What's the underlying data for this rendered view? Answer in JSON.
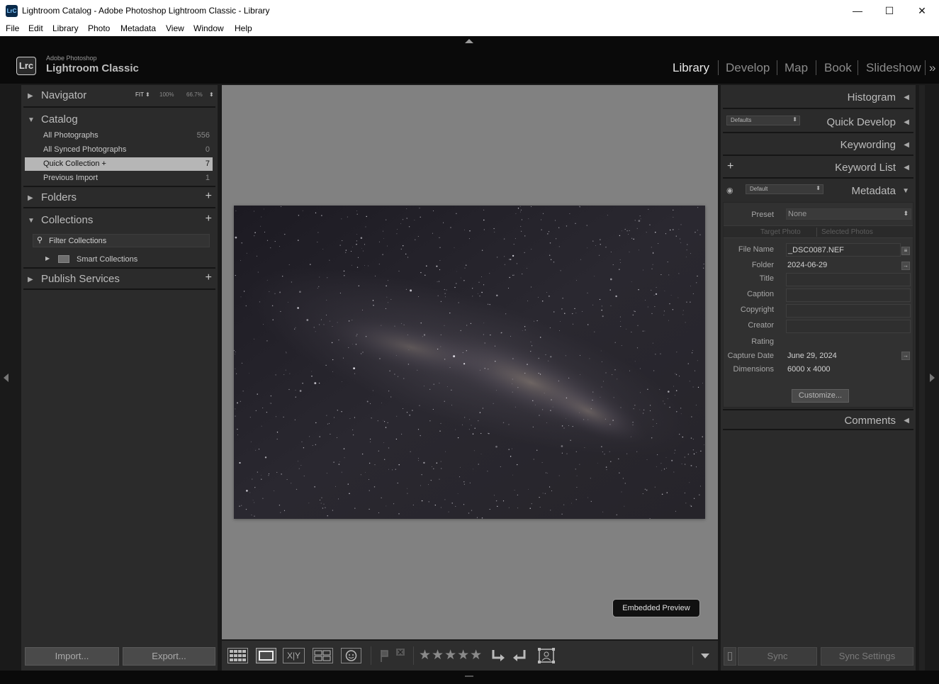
{
  "window": {
    "title": "Lightroom Catalog - Adobe Photoshop Lightroom Classic - Library",
    "app_icon_text": "LrC",
    "controls": {
      "minimize": "—",
      "maximize": "☐",
      "close": "✕"
    }
  },
  "menu": [
    "File",
    "Edit",
    "Library",
    "Photo",
    "Metadata",
    "View",
    "Window",
    "Help"
  ],
  "identity": {
    "logo": "Lrc",
    "sub": "Adobe Photoshop",
    "main": "Lightroom Classic"
  },
  "modules": [
    "Library",
    "Develop",
    "Map",
    "Book",
    "Slideshow"
  ],
  "modules_more": "»",
  "active_module": "Library",
  "left": {
    "navigator": {
      "label": "Navigator",
      "options": [
        "FIT",
        "100%",
        "66.7%"
      ]
    },
    "catalog": {
      "label": "Catalog",
      "items": [
        {
          "name": "All Photographs",
          "count": "556"
        },
        {
          "name": "All Synced Photographs",
          "count": "0"
        },
        {
          "name": "Quick Collection  +",
          "count": "7"
        },
        {
          "name": "Previous Import",
          "count": "1"
        }
      ]
    },
    "folders": {
      "label": "Folders"
    },
    "collections": {
      "label": "Collections",
      "filter_label": "Filter Collections",
      "smart_label": "Smart Collections"
    },
    "publish": {
      "label": "Publish Services"
    },
    "import_label": "Import...",
    "export_label": "Export..."
  },
  "center": {
    "badge": "Embedded Preview"
  },
  "right": {
    "histogram": "Histogram",
    "quick_develop": {
      "label": "Quick Develop",
      "preset": "Defaults"
    },
    "keywording": "Keywording",
    "keyword_list": "Keyword List",
    "metadata": {
      "label": "Metadata",
      "set": "Default",
      "preset_label": "Preset",
      "preset_value": "None",
      "target_tab": "Target Photo",
      "selected_tab": "Selected Photos",
      "fields": [
        {
          "label": "File Name",
          "value": "_DSC0087.NEF"
        },
        {
          "label": "Folder",
          "value": "2024-06-29"
        },
        {
          "label": "Title",
          "value": ""
        },
        {
          "label": "Caption",
          "value": ""
        },
        {
          "label": "Copyright",
          "value": ""
        },
        {
          "label": "Creator",
          "value": ""
        },
        {
          "label": "Rating",
          "value": ""
        },
        {
          "label": "Capture Date",
          "value": "June 29, 2024"
        },
        {
          "label": "Dimensions",
          "value": "6000 x 4000"
        }
      ],
      "customize": "Customize..."
    },
    "comments": "Comments",
    "sync": "Sync",
    "sync_settings": "Sync Settings"
  },
  "toolbar": {
    "compare_label": "X|Y",
    "rating_stars": "★★★★★"
  },
  "colors": {
    "panel_bg": "#2b2b2b",
    "center_bg": "#818181",
    "active_module": "#e8e8e8",
    "selected_row": "#b6b6b6"
  }
}
